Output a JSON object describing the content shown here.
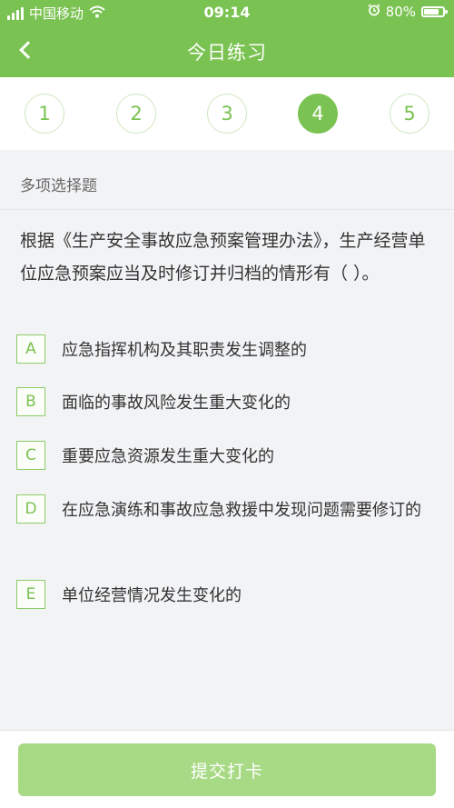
{
  "status_bar": {
    "carrier": "中国移动",
    "time": "09:14",
    "battery": "80%",
    "battery_level": 0.8
  },
  "navbar": {
    "title": "今日练习"
  },
  "steps": {
    "items": [
      "1",
      "2",
      "3",
      "4",
      "5"
    ],
    "active_index": 3
  },
  "question": {
    "type": "多项选择题",
    "text": "根据《生产安全事故应急预案管理办法》，生产经营单位应急预案应当及时修订并归档的情形有（    ）。",
    "options": [
      {
        "letter": "A",
        "text": "应急指挥机构及其职责发生调整的"
      },
      {
        "letter": "B",
        "text": "面临的事故风险发生重大变化的"
      },
      {
        "letter": "C",
        "text": "重要应急资源发生重大变化的"
      },
      {
        "letter": "D",
        "text": "在应急演练和事故应急救援中发现问题需要修订的"
      },
      {
        "letter": "E",
        "text": "单位经营情况发生变化的"
      }
    ]
  },
  "submit": {
    "label": "提交打卡"
  },
  "colors": {
    "accent": "#7ac251",
    "submit_bg": "#a8da86",
    "background": "#f2f3f5"
  }
}
